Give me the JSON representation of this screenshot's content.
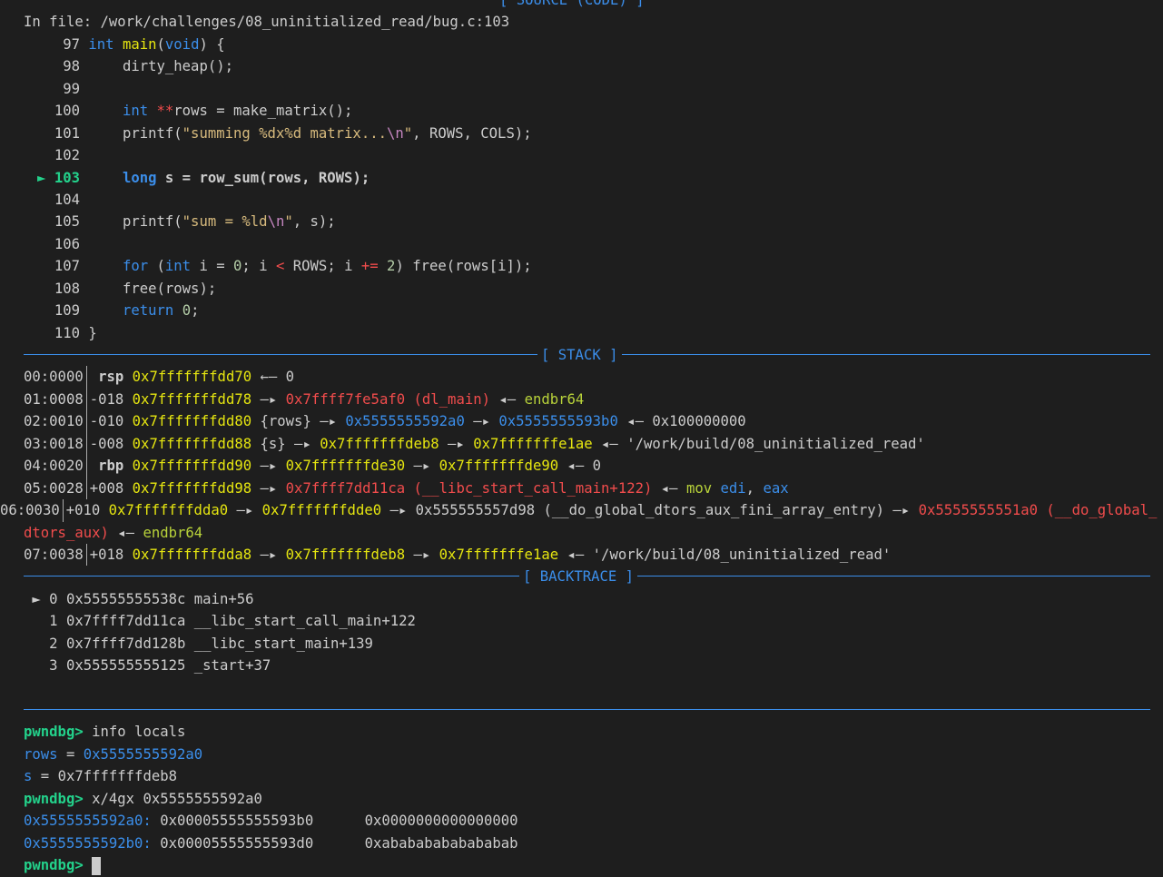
{
  "headers": {
    "source": "[ SOURCE (CODE) ]",
    "stack": "[ STACK ]",
    "backtrace": "[ BACKTRACE ]"
  },
  "source": {
    "file_line": "In file: /work/challenges/08_uninitialized_read/bug.c:103",
    "lines": [
      {
        "num": "97",
        "code": "int main(void) {"
      },
      {
        "num": "98",
        "code": "    dirty_heap();"
      },
      {
        "num": "99",
        "code": ""
      },
      {
        "num": "100",
        "code": "    int **rows = make_matrix();"
      },
      {
        "num": "101",
        "code": "    printf(\"summing %dx%d matrix...\\n\", ROWS, COLS);"
      },
      {
        "num": "102",
        "code": ""
      },
      {
        "num": "103",
        "code": "    long s = row_sum(rows, ROWS);",
        "current": true
      },
      {
        "num": "104",
        "code": ""
      },
      {
        "num": "105",
        "code": "    printf(\"sum = %ld\\n\", s);"
      },
      {
        "num": "106",
        "code": ""
      },
      {
        "num": "107",
        "code": "    for (int i = 0; i < ROWS; i += 2) free(rows[i]);"
      },
      {
        "num": "108",
        "code": "    free(rows);"
      },
      {
        "num": "109",
        "code": "    return 0;"
      },
      {
        "num": "110",
        "code": "}"
      }
    ],
    "current_marker": "►"
  },
  "stack": [
    {
      "idx": "00:0000",
      "off": " rsp",
      "text": "0x7fffffffdd70 ←— 0"
    },
    {
      "idx": "01:0008",
      "off": "-018",
      "text": "0x7fffffffdd78 —▸ 0x7ffff7fe5af0 (dl_main) ◂— endbr64"
    },
    {
      "idx": "02:0010",
      "off": "-010",
      "text": "0x7fffffffdd80 {rows} —▸ 0x5555555592a0 —▸ 0x5555555593b0 ◂— 0x100000000"
    },
    {
      "idx": "03:0018",
      "off": "-008",
      "text": "0x7fffffffdd88 {s} —▸ 0x7fffffffdeb8 —▸ 0x7fffffffe1ae ◂— '/work/build/08_uninitialized_read'"
    },
    {
      "idx": "04:0020",
      "off": " rbp",
      "text": "0x7fffffffdd90 —▸ 0x7fffffffde30 —▸ 0x7fffffffde90 ◂— 0"
    },
    {
      "idx": "05:0028",
      "off": "+008",
      "text": "0x7fffffffdd98 —▸ 0x7ffff7dd11ca (__libc_start_call_main+122) ◂— mov edi, eax"
    },
    {
      "idx": "06:0030",
      "off": "+010",
      "text": "0x7fffffffdda0 —▸ 0x7fffffffdde0 —▸ 0x555555557d98 (__do_global_dtors_aux_fini_array_entry) —▸ 0x5555555551a0 (__do_global_dtors_aux) ◂— endbr64"
    },
    {
      "idx": "07:0038",
      "off": "+018",
      "text": "0x7fffffffdda8 —▸ 0x7fffffffdeb8 —▸ 0x7fffffffe1ae ◂— '/work/build/08_uninitialized_read'"
    }
  ],
  "backtrace": [
    {
      "marker": "►",
      "n": "0",
      "addr": "0x55555555538c",
      "sym": "main+56"
    },
    {
      "marker": "",
      "n": "1",
      "addr": "0x7ffff7dd11ca",
      "sym": "__libc_start_call_main+122"
    },
    {
      "marker": "",
      "n": "2",
      "addr": "0x7ffff7dd128b",
      "sym": "__libc_start_main+139"
    },
    {
      "marker": "",
      "n": "3",
      "addr": "0x555555555125",
      "sym": "_start+37"
    }
  ],
  "console": {
    "prompt": "pwndbg>",
    "cmd1": "info locals",
    "local1_name": "rows",
    "local1_value": "0x5555555592a0",
    "local2_name": "s",
    "local2_value": "0x7fffffffdeb8",
    "cmd2": "x/4gx 0x5555555592a0",
    "mem": [
      {
        "addr": "0x5555555592a0:",
        "v1": "0x00005555555593b0",
        "v2": "0x0000000000000000"
      },
      {
        "addr": "0x5555555592b0:",
        "v1": "0x00005555555593d0",
        "v2": "0xabababababababab"
      }
    ]
  },
  "colors": {
    "background": "#1e1e1e",
    "accent": "#3b8eea",
    "prompt": "#23d18b",
    "pointer": "#e5e510",
    "code_ptr": "#f14c4c"
  }
}
